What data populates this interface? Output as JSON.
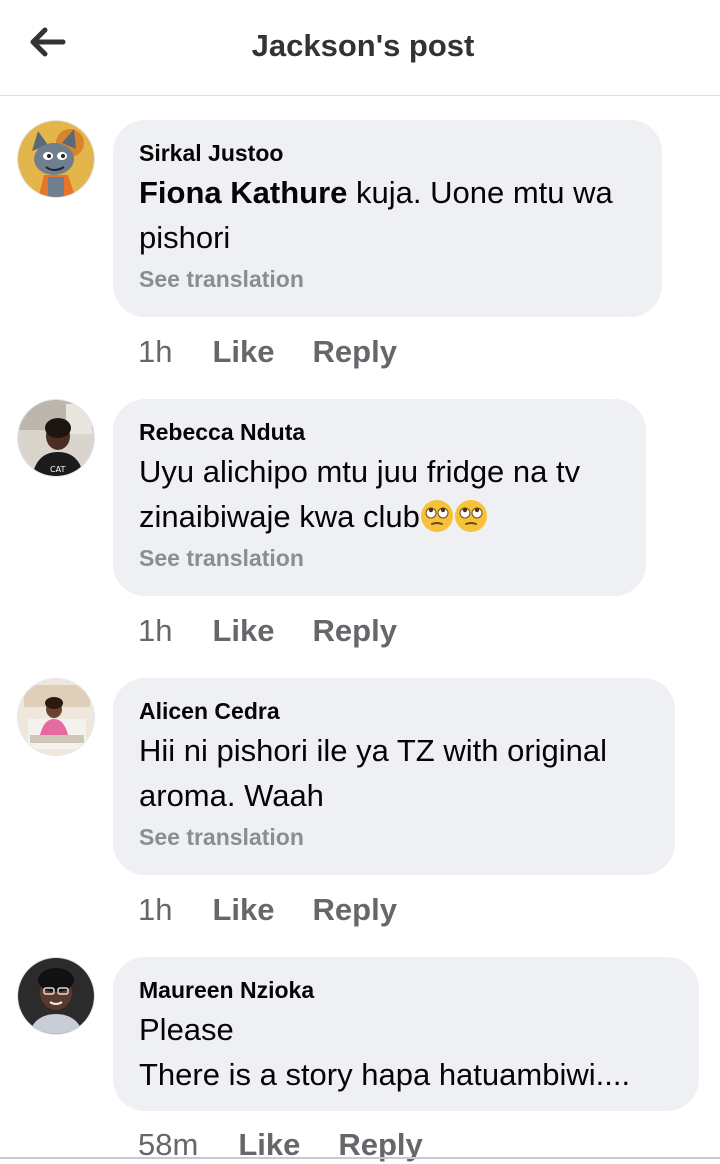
{
  "header": {
    "back_icon": "arrow-left-icon",
    "title": "Jackson's post"
  },
  "colors": {
    "bubble_bg": "#eff0f4",
    "meta_text": "#65676b",
    "translation_text": "#8a8d91"
  },
  "comments": [
    {
      "author": "Sirkal Justoo",
      "mention": "Fiona Kathure",
      "text": " kuja. Uone mtu wa pishori",
      "see_translation": "See translation",
      "time": "1h",
      "like": "Like",
      "reply": "Reply",
      "avatar_icon": "cartoon-cat-avatar"
    },
    {
      "author": "Rebecca Nduta",
      "text": "Uyu alichipo mtu juu fridge na tv zinaibiwaje kwa club",
      "emoji": "face-with-rolling-eyes",
      "see_translation": "See translation",
      "time": "1h",
      "like": "Like",
      "reply": "Reply",
      "avatar_icon": "person-photo-avatar"
    },
    {
      "author": "Alicen Cedra",
      "text": "Hii ni pishori ile ya TZ with original aroma. Waah",
      "see_translation": "See translation",
      "time": "1h",
      "like": "Like",
      "reply": "Reply",
      "avatar_icon": "person-photo-avatar"
    },
    {
      "author": "Maureen Nzioka",
      "text": "Please\nThere is a story hapa hatuambiwi....",
      "time": "58m",
      "like": "Like",
      "reply": "Reply",
      "avatar_icon": "person-photo-avatar"
    }
  ]
}
